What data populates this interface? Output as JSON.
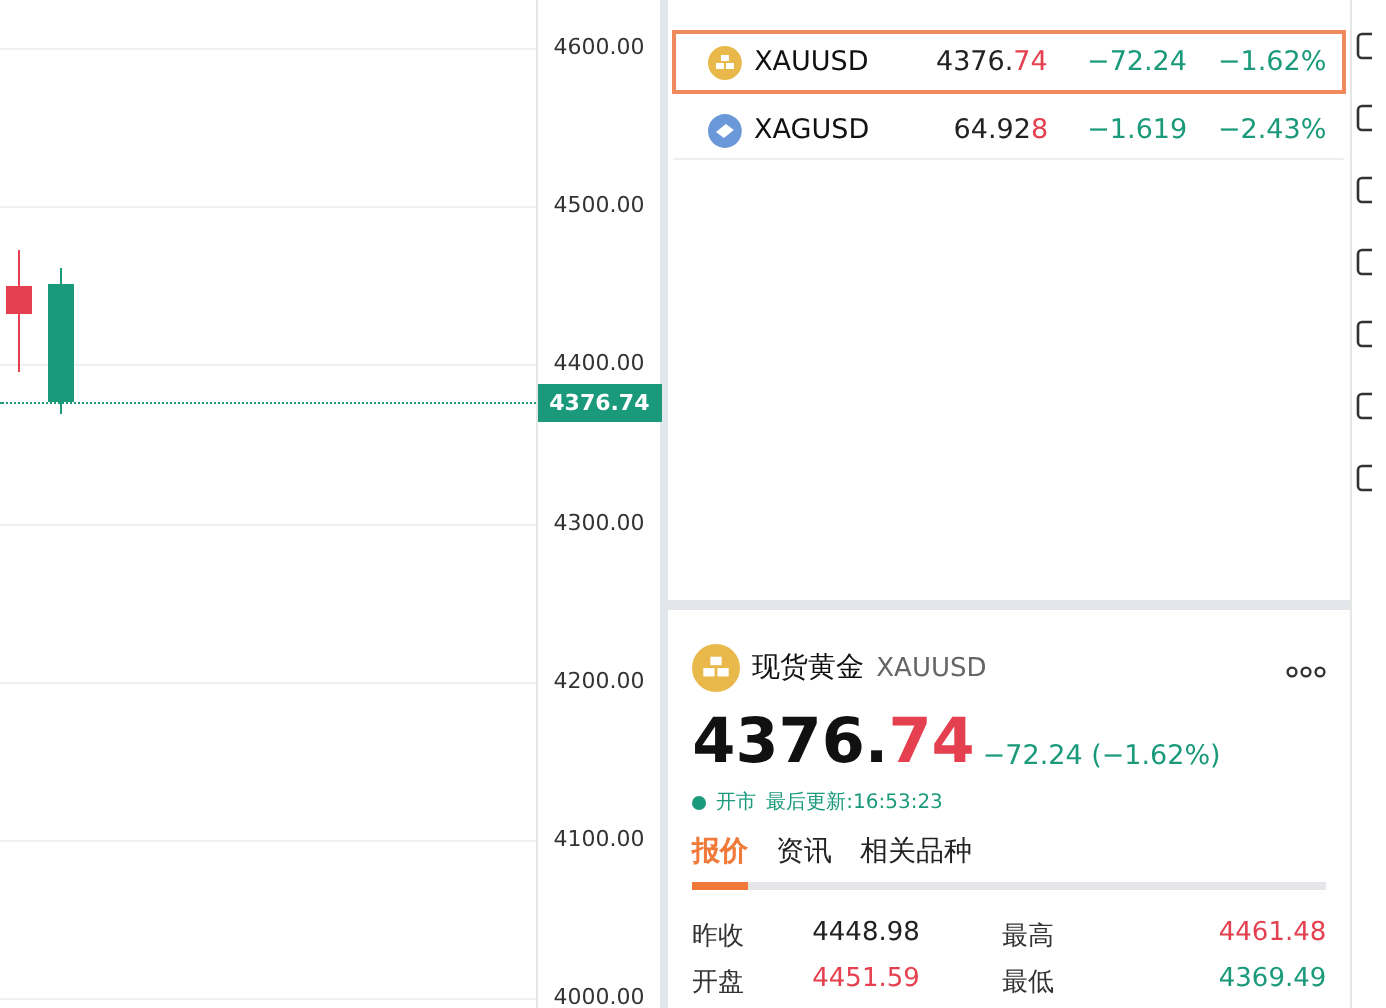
{
  "chart": {
    "ticks": [
      "4600.00",
      "4500.00",
      "4400.00",
      "4300.00",
      "4200.00",
      "4100.00",
      "4000.00"
    ],
    "last_price": "4376.74"
  },
  "watchlist": [
    {
      "symbol": "XAUUSD",
      "kind": "gold",
      "price_main": "4376.",
      "price_tail": "74",
      "change": "−72.24",
      "percent": "−1.62%",
      "selected": true
    },
    {
      "symbol": "XAGUSD",
      "kind": "silver",
      "price_main": "64.92",
      "price_tail": "8",
      "change": "−1.619",
      "percent": "−2.43%",
      "selected": false
    }
  ],
  "detail": {
    "name": "现货黄金",
    "symbol": "XAUUSD",
    "price_main": "4376.",
    "price_tail": "74",
    "change": "−72.24 (−1.62%)",
    "status": "开市",
    "updated": "最后更新:16:53:23",
    "tabs": [
      {
        "label": "报价",
        "selected": true
      },
      {
        "label": "资讯",
        "selected": false
      },
      {
        "label": "相关品种",
        "selected": false
      }
    ],
    "stats": [
      {
        "label": "昨收",
        "value": "4448.98",
        "color": "#222222"
      },
      {
        "label": "最高",
        "value": "4461.48",
        "color": "#e5404f"
      },
      {
        "label": "开盘",
        "value": "4451.59",
        "color": "#e5404f"
      },
      {
        "label": "最低",
        "value": "4369.49",
        "color": "#1a9a7b"
      }
    ]
  }
}
